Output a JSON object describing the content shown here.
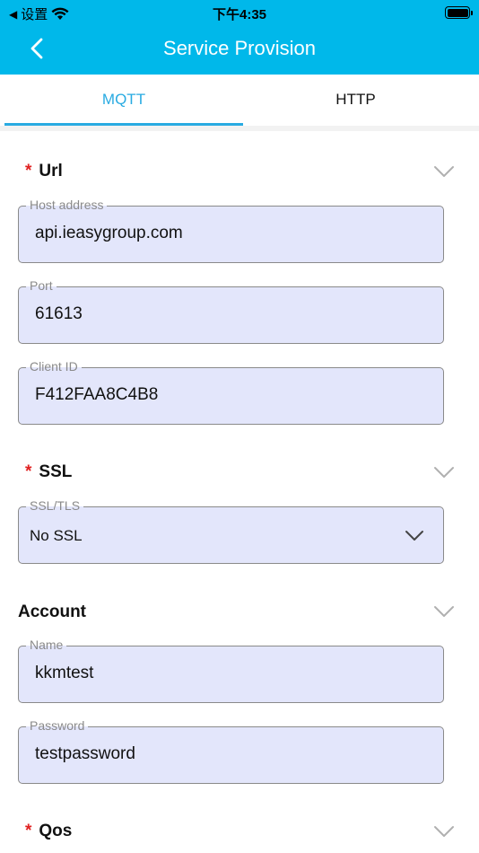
{
  "status_bar": {
    "carrier": "设置",
    "time": "下午4:35"
  },
  "nav": {
    "title": "Service Provision",
    "back_icon": "chevron-left-icon"
  },
  "tabs": [
    {
      "label": "MQTT",
      "active": true
    },
    {
      "label": "HTTP",
      "active": false
    }
  ],
  "colors": {
    "primary": "#00b8ea",
    "tab_active": "#29abe2",
    "field_bg": "#e3e6fb",
    "required": "#e02020"
  },
  "sections": {
    "url": {
      "star": "*",
      "title": "Url",
      "host": {
        "label": "Host address",
        "value": "api.ieasygroup.com"
      },
      "port": {
        "label": "Port",
        "value": "61613"
      },
      "client_id": {
        "label": "Client ID",
        "value": "F412FAA8C4B8"
      }
    },
    "ssl": {
      "star": "*",
      "title": "SSL",
      "mode": {
        "label": "SSL/TLS",
        "value": "No SSL"
      }
    },
    "account": {
      "title": "Account",
      "name": {
        "label": "Name",
        "value": "kkmtest"
      },
      "password": {
        "label": "Password",
        "value": "testpassword"
      }
    },
    "qos": {
      "star": "*",
      "title": "Qos"
    }
  }
}
